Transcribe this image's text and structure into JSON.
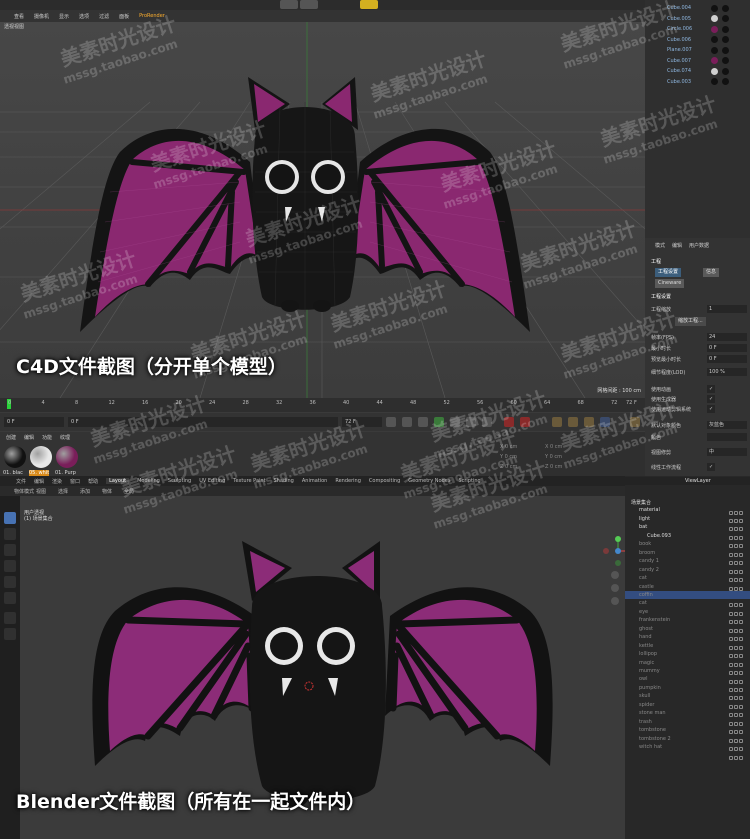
{
  "c4d": {
    "menu": [
      "查看",
      "摄像机",
      "显示",
      "选项",
      "过滤",
      "面板",
      "ProRender"
    ],
    "viewport_label": "透视视图",
    "grid_readout": "网格间距 : 100 cm",
    "caption": "C4D文件截图（分开单个模型）",
    "timeline_ticks": [
      "0",
      "4",
      "8",
      "12",
      "16",
      "20",
      "24",
      "28",
      "32",
      "36",
      "40",
      "44",
      "48",
      "52",
      "56",
      "60",
      "64",
      "68",
      "72"
    ],
    "timeline_end": "72 F",
    "transport": {
      "start_field": "0 F",
      "left_field": "0 F",
      "end_field": "72 F",
      "right_field": "72 F"
    },
    "material_tabs": [
      "创建",
      "编辑",
      "功能",
      "纹理"
    ],
    "materials": [
      {
        "name": "01. blac",
        "color": "#111111"
      },
      {
        "name": "05. whit",
        "color": "#e8e8e8"
      },
      {
        "name": "01. Purp",
        "color": "#7a1e5a"
      }
    ],
    "coords": [
      "X  0 cm",
      "Y  0 cm",
      "Z  0 cm"
    ],
    "objects": [
      {
        "name": "Cube.004",
        "color": "#111111"
      },
      {
        "name": "Cube.005",
        "color": "#d0d0d0"
      },
      {
        "name": "Circle.006",
        "color": "#7a1e5a"
      },
      {
        "name": "Cube.006",
        "color": "#111111"
      },
      {
        "name": "Plane.007",
        "color": "#111111"
      },
      {
        "name": "Cube.007",
        "color": "#7a1e5a"
      },
      {
        "name": "Cube.074",
        "color": "#d0d0d0"
      },
      {
        "name": "Cube.003",
        "color": "#111111"
      }
    ],
    "attr_tabs": [
      "模式",
      "编辑",
      "用户数据"
    ],
    "attr_title": "工程",
    "attr_subtabs": [
      "工程设置",
      "信息",
      "Cineware"
    ],
    "attr_section": "工程设置",
    "attr_rows": [
      {
        "label": "工程缩放",
        "value": "1"
      },
      {
        "label": "帧率(FPS)",
        "value": "24"
      },
      {
        "label": "最小时长",
        "value": "0 F"
      },
      {
        "label": "预览最小时长",
        "value": "0 F"
      },
      {
        "label": "细节程度(LOD)",
        "value": "100 %"
      },
      {
        "label": "使用动画",
        "value": "✓"
      },
      {
        "label": "使用生成器",
        "value": "✓"
      },
      {
        "label": "使用运动剪辑系统",
        "value": "✓"
      },
      {
        "label": "默认对象颜色",
        "value": "灰蓝色"
      },
      {
        "label": "颜色",
        "value": ""
      },
      {
        "label": "视图修剪",
        "value": "中"
      },
      {
        "label": "线性工作流程",
        "value": "✓"
      }
    ],
    "attr_button": "缩放工程..."
  },
  "blender": {
    "menu": [
      "文件",
      "编辑",
      "渲染",
      "窗口",
      "帮助",
      "Layout",
      "Modeling",
      "Sculpting",
      "UV Editing",
      "Texture Paint",
      "Shading",
      "Animation",
      "Rendering",
      "Compositing",
      "Geometry Nodes",
      "Scripting"
    ],
    "active_workspace": "Layout",
    "header": [
      "物体模式",
      "视图",
      "选择",
      "添加",
      "物体",
      "全局"
    ],
    "collection_label": [
      "用户透视",
      "(1) 场景集合"
    ],
    "caption": "Blender文件截图（所有在一起文件内）",
    "view_layer": "ViewLayer",
    "outliner": [
      {
        "name": "场景集合",
        "level": 0,
        "dim": false
      },
      {
        "name": "material",
        "level": 1,
        "dim": false
      },
      {
        "name": "light",
        "level": 1,
        "dim": false
      },
      {
        "name": "bat",
        "level": 1,
        "dim": false
      },
      {
        "name": "Cube.093",
        "level": 2,
        "dim": false
      },
      {
        "name": "book",
        "level": 1,
        "dim": true
      },
      {
        "name": "broom",
        "level": 1,
        "dim": true
      },
      {
        "name": "candy 1",
        "level": 1,
        "dim": true
      },
      {
        "name": "candy 2",
        "level": 1,
        "dim": true
      },
      {
        "name": "cat",
        "level": 1,
        "dim": true
      },
      {
        "name": "castle",
        "level": 1,
        "dim": true
      },
      {
        "name": "coffin",
        "level": 1,
        "dim": true
      },
      {
        "name": "cat",
        "level": 1,
        "dim": true
      },
      {
        "name": "eye",
        "level": 1,
        "dim": true
      },
      {
        "name": "frankenstein",
        "level": 1,
        "dim": true
      },
      {
        "name": "ghost",
        "level": 1,
        "dim": true
      },
      {
        "name": "hand",
        "level": 1,
        "dim": true
      },
      {
        "name": "kettle",
        "level": 1,
        "dim": true
      },
      {
        "name": "lollipop",
        "level": 1,
        "dim": true
      },
      {
        "name": "magic",
        "level": 1,
        "dim": true
      },
      {
        "name": "mummy",
        "level": 1,
        "dim": true
      },
      {
        "name": "owl",
        "level": 1,
        "dim": true
      },
      {
        "name": "pumpkin",
        "level": 1,
        "dim": true
      },
      {
        "name": "skull",
        "level": 1,
        "dim": true
      },
      {
        "name": "spider",
        "level": 1,
        "dim": true
      },
      {
        "name": "stone man",
        "level": 1,
        "dim": true
      },
      {
        "name": "trash",
        "level": 1,
        "dim": true
      },
      {
        "name": "tombstone",
        "level": 1,
        "dim": true
      },
      {
        "name": "tombstone 2",
        "level": 1,
        "dim": true
      },
      {
        "name": "witch hat",
        "level": 1,
        "dim": true
      }
    ]
  },
  "watermark": {
    "cn": "美素时光设计",
    "en": "mssg.taobao.com"
  },
  "colors": {
    "bat_body": "#141414",
    "wing": "#8a2870",
    "bl_wing": "#8c2c78",
    "accent_blue": "#4772b3"
  }
}
